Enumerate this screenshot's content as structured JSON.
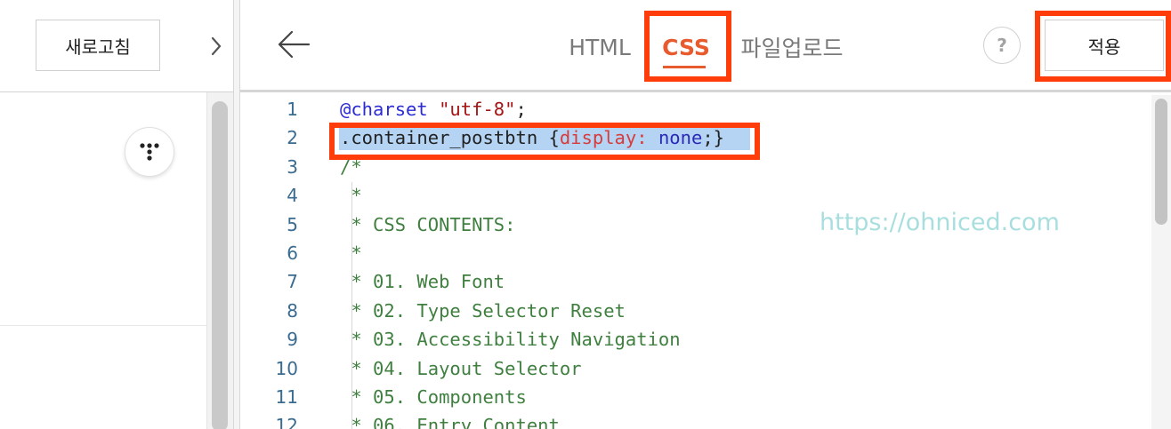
{
  "left_panel": {
    "refresh_label": "새로고침",
    "chevron_icon": "chevron-right-icon",
    "more_icon": "more-dots-icon"
  },
  "header": {
    "back_icon": "arrow-left-icon",
    "tabs": [
      {
        "label": "HTML",
        "active": false
      },
      {
        "label": "CSS",
        "active": true
      },
      {
        "label": "파일업로드",
        "active": false
      }
    ],
    "help_label": "?",
    "apply_label": "적용",
    "active_color": "#e85b2e",
    "highlight_color": "#ff3d0a"
  },
  "editor": {
    "lines": [
      {
        "no": "1",
        "tokens": [
          {
            "text": "@charset",
            "cls": "kw"
          },
          {
            "text": " ",
            "cls": "plain"
          },
          {
            "text": "\"utf-8\"",
            "cls": "str"
          },
          {
            "text": ";",
            "cls": "plain"
          }
        ]
      },
      {
        "no": "2",
        "tokens": [
          {
            "text": ".container_postbtn ",
            "cls": "plain"
          },
          {
            "text": "{",
            "cls": "plain"
          },
          {
            "text": "display:",
            "cls": "prop"
          },
          {
            "text": " ",
            "cls": "plain"
          },
          {
            "text": "none",
            "cls": "val"
          },
          {
            "text": ";}",
            "cls": "plain"
          }
        ],
        "selected": true
      },
      {
        "no": "3",
        "tokens": [
          {
            "text": "/*",
            "cls": "cmt"
          }
        ]
      },
      {
        "no": "4",
        "tokens": [
          {
            "text": " *",
            "cls": "cmt"
          }
        ]
      },
      {
        "no": "5",
        "tokens": [
          {
            "text": " * CSS CONTENTS:",
            "cls": "cmt"
          }
        ]
      },
      {
        "no": "6",
        "tokens": [
          {
            "text": " *",
            "cls": "cmt"
          }
        ]
      },
      {
        "no": "7",
        "tokens": [
          {
            "text": " * 01. Web Font",
            "cls": "cmt"
          }
        ]
      },
      {
        "no": "8",
        "tokens": [
          {
            "text": " * 02. Type Selector Reset",
            "cls": "cmt"
          }
        ]
      },
      {
        "no": "9",
        "tokens": [
          {
            "text": " * 03. Accessibility Navigation",
            "cls": "cmt"
          }
        ]
      },
      {
        "no": "10",
        "tokens": [
          {
            "text": " * 04. Layout Selector",
            "cls": "cmt"
          }
        ]
      },
      {
        "no": "11",
        "tokens": [
          {
            "text": " * 05. Components",
            "cls": "cmt"
          }
        ]
      },
      {
        "no": "12",
        "tokens": [
          {
            "text": " * 06. Entry Content",
            "cls": "cmt"
          }
        ]
      }
    ],
    "watermark": "https://ohniced.com"
  }
}
